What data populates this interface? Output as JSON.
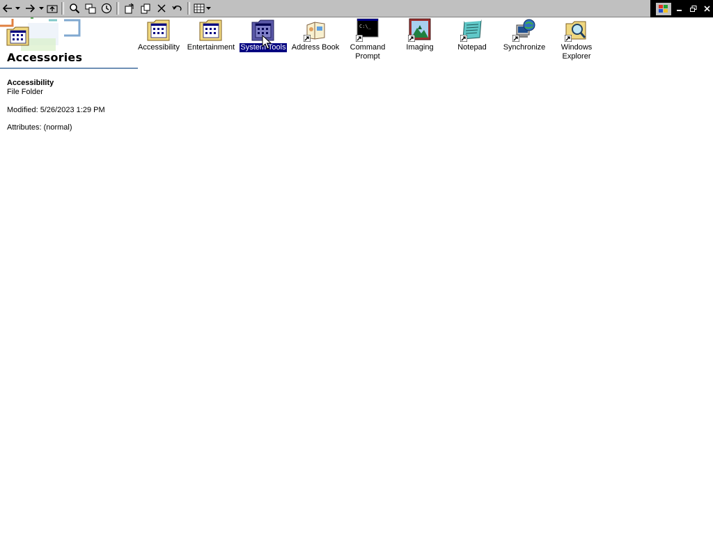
{
  "toolbar": {
    "buttons": [
      {
        "name": "back-button",
        "icon": "back-arrow-icon"
      },
      {
        "name": "forward-button",
        "icon": "forward-arrow-icon"
      },
      {
        "name": "up-button",
        "icon": "up-folder-icon"
      },
      {
        "name": "search-button",
        "icon": "search-icon"
      },
      {
        "name": "folders-button",
        "icon": "folders-icon"
      },
      {
        "name": "history-button",
        "icon": "history-icon"
      },
      {
        "name": "move-to-button",
        "icon": "move-to-icon"
      },
      {
        "name": "copy-to-button",
        "icon": "copy-to-icon"
      },
      {
        "name": "delete-button",
        "icon": "delete-icon"
      },
      {
        "name": "undo-button",
        "icon": "undo-icon"
      },
      {
        "name": "views-button",
        "icon": "views-icon"
      }
    ]
  },
  "window_controls": {
    "logo": "windows-logo-icon",
    "minimize": "minimize-icon",
    "restore": "restore-icon",
    "close": "close-icon"
  },
  "info_pane": {
    "folder_title": "Accessories",
    "selected_name": "Accessibility",
    "selected_type": "File Folder",
    "modified": "Modified: 5/26/2023 1:29 PM",
    "attributes": "Attributes: (normal)"
  },
  "icons": [
    {
      "label": "Accessibility",
      "icon": "program-folder-icon",
      "selected": false
    },
    {
      "label": "Entertainment",
      "icon": "program-folder-icon",
      "selected": false
    },
    {
      "label": "System Tools",
      "icon": "program-folder-icon",
      "selected": true
    },
    {
      "label": "Address Book",
      "icon": "address-book-icon",
      "selected": false
    },
    {
      "label": "Command\nPrompt",
      "icon": "command-prompt-icon",
      "selected": false
    },
    {
      "label": "Imaging",
      "icon": "imaging-icon",
      "selected": false
    },
    {
      "label": "Notepad",
      "icon": "notepad-icon",
      "selected": false
    },
    {
      "label": "Synchronize",
      "icon": "synchronize-icon",
      "selected": false
    },
    {
      "label": "Windows\nExplorer",
      "icon": "windows-explorer-icon",
      "selected": false
    }
  ],
  "colors": {
    "selection": "#000080",
    "toolbar": "#c0c0c0",
    "banner_line": "#6e8fb5"
  }
}
